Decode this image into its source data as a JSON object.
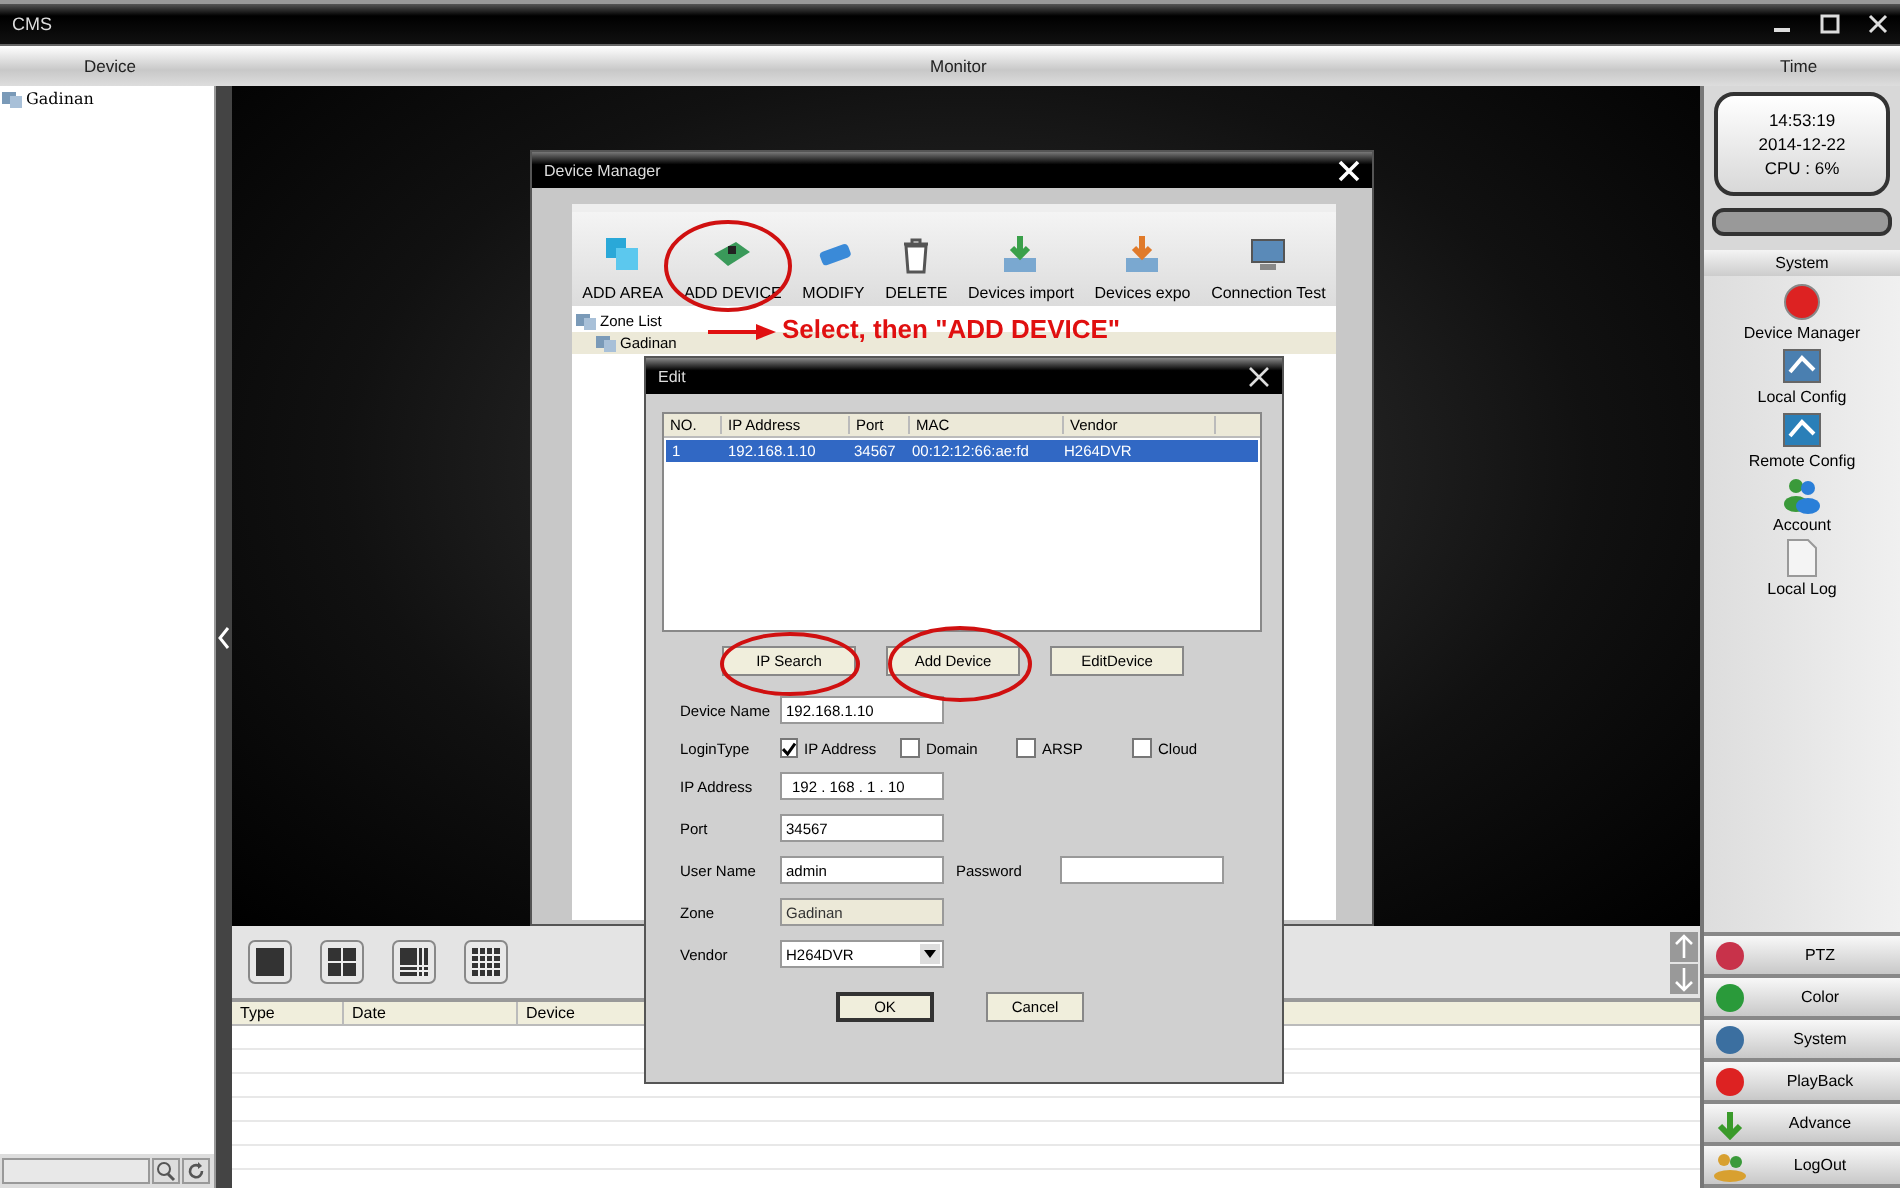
{
  "window": {
    "title": "CMS"
  },
  "header": {
    "columns": [
      "Device",
      "Monitor",
      "Time"
    ]
  },
  "device_tree": [
    {
      "label": "Gadinan"
    }
  ],
  "status": {
    "time": "14:53:19",
    "date": "2014-12-22",
    "cpu": "CPU : 6%"
  },
  "system_panel": {
    "title": "System",
    "items": [
      {
        "label": "Device Manager",
        "kind": "record"
      },
      {
        "label": "Local Config",
        "kind": "config"
      },
      {
        "label": "Remote Config",
        "kind": "remote"
      },
      {
        "label": "Account",
        "kind": "account"
      },
      {
        "label": "Local Log",
        "kind": "log"
      }
    ]
  },
  "bottom_buttons": [
    {
      "label": "PTZ",
      "kind": "ptz"
    },
    {
      "label": "Color",
      "kind": "color"
    },
    {
      "label": "System",
      "kind": "system"
    },
    {
      "label": "PlayBack",
      "kind": "playback"
    },
    {
      "label": "Advance",
      "kind": "advance"
    },
    {
      "label": "LogOut",
      "kind": "logout"
    }
  ],
  "log_table": {
    "columns": [
      "Type",
      "Date",
      "Device"
    ]
  },
  "device_manager": {
    "title": "Device Manager",
    "toolbar": [
      {
        "label": "ADD AREA",
        "kind": "area"
      },
      {
        "label": "ADD DEVICE",
        "kind": "device"
      },
      {
        "label": "MODIFY",
        "kind": "modify"
      },
      {
        "label": "DELETE",
        "kind": "delete"
      },
      {
        "label": "Devices import",
        "kind": "import"
      },
      {
        "label": "Devices expo",
        "kind": "export"
      },
      {
        "label": "Connection Test",
        "kind": "connection"
      }
    ],
    "zone_tree": {
      "label": "Zone List",
      "children": [
        {
          "label": "Gadinan",
          "selected": true
        }
      ]
    },
    "annotation": "Select, then \"ADD DEVICE\""
  },
  "edit_dialog": {
    "title": "Edit",
    "table": {
      "columns": [
        "NO.",
        "IP Address",
        "Port",
        "MAC",
        "Vendor"
      ],
      "rows": [
        {
          "cells": [
            "1",
            "192.168.1.10",
            "34567",
            "00:12:12:66:ae:fd",
            "H264DVR"
          ],
          "selected": true
        }
      ]
    },
    "buttons": [
      "IP Search",
      "Add Device",
      "EditDevice"
    ],
    "device_name": {
      "label": "Device Name",
      "value": "192.168.1.10"
    },
    "login_type": {
      "label": "LoginType",
      "options": [
        {
          "label": "IP Address",
          "checked": true
        },
        {
          "label": "Domain",
          "checked": false
        },
        {
          "label": "ARSP",
          "checked": false
        },
        {
          "label": "Cloud",
          "checked": false
        }
      ]
    },
    "ip_address": {
      "label": "IP Address",
      "value": "192 . 168 . 1 . 10"
    },
    "port": {
      "label": "Port",
      "value": "34567"
    },
    "user_name": {
      "label": "User Name",
      "value": "admin"
    },
    "password": {
      "label": "Password"
    },
    "zone": {
      "label": "Zone",
      "value": "Gadinan",
      "disabled": true
    },
    "vendor": {
      "label": "Vendor",
      "value": "H264DVR"
    },
    "actions": [
      "OK",
      "Cancel"
    ]
  }
}
